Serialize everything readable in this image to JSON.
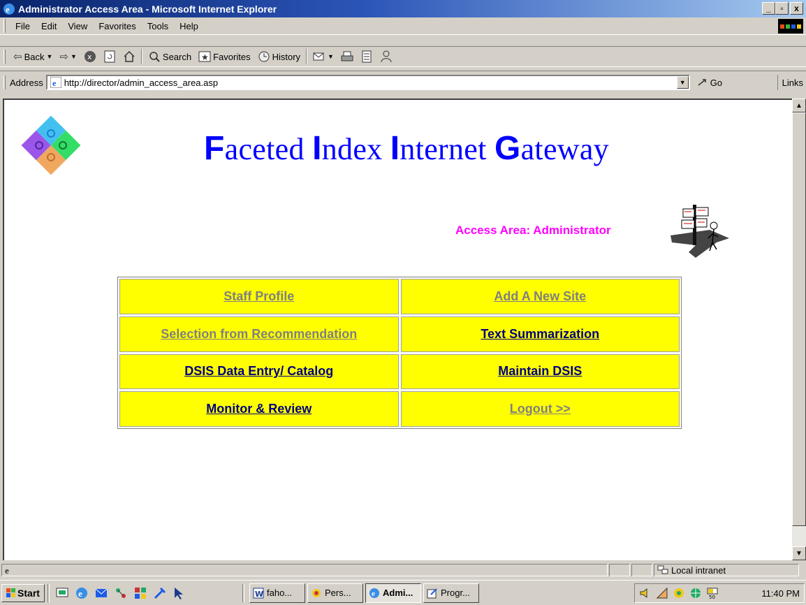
{
  "window": {
    "title": "Administrator Access Area - Microsoft Internet Explorer",
    "controls": [
      "_",
      "▫",
      "x"
    ]
  },
  "menu": [
    "File",
    "Edit",
    "View",
    "Favorites",
    "Tools",
    "Help"
  ],
  "toolbar": {
    "back": "Back",
    "search": "Search",
    "favorites": "Favorites",
    "history": "History"
  },
  "address": {
    "label": "Address",
    "url": "http://director/admin_access_area.asp",
    "go": "Go",
    "links": "Links"
  },
  "page": {
    "title_parts": [
      {
        "big": "F",
        "rest": "aceted "
      },
      {
        "big": "I",
        "rest": "ndex "
      },
      {
        "big": "I",
        "rest": "nternet "
      },
      {
        "big": "G",
        "rest": "ateway"
      }
    ],
    "access_area": "Access Area: Administrator",
    "links": [
      {
        "label": "Staff Profile",
        "state": "visited"
      },
      {
        "label": "Add A  New Site",
        "state": "visited"
      },
      {
        "label": "Selection from Recommendation",
        "state": "visited"
      },
      {
        "label": "Text Summarization",
        "state": "active"
      },
      {
        "label": "DSIS Data Entry/ Catalog",
        "state": "active"
      },
      {
        "label": "Maintain DSIS",
        "state": "active"
      },
      {
        "label": "Monitor & Review",
        "state": "active"
      },
      {
        "label": "Logout >>",
        "state": "visited"
      }
    ],
    "colors": {
      "title": "#0000ff",
      "access": "#ff00ff",
      "cell_bg": "#ffff00",
      "link_active": "#000080",
      "link_visited": "#808080"
    }
  },
  "status": {
    "zone": "Local intranet"
  },
  "taskbar": {
    "start": "Start",
    "tasks": [
      {
        "label": "faho...",
        "icon": "word-icon",
        "pressed": false
      },
      {
        "label": "Pers...",
        "icon": "persona-icon",
        "pressed": false
      },
      {
        "label": "Admi...",
        "icon": "ie-icon",
        "pressed": true
      },
      {
        "label": "Progr...",
        "icon": "program-icon",
        "pressed": false
      }
    ],
    "clock": "11:40 PM"
  }
}
